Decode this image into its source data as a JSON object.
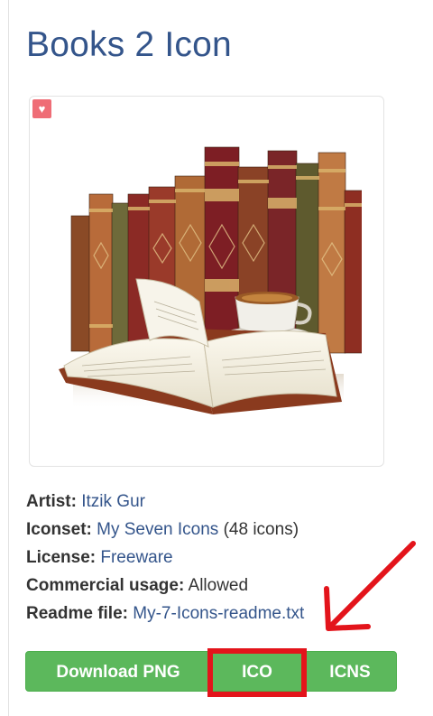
{
  "title": "Books 2 Icon",
  "favorite_icon": "heart-icon",
  "details": {
    "artist_label": "Artist:",
    "artist_value": "Itzik Gur",
    "iconset_label": "Iconset:",
    "iconset_value": "My Seven Icons",
    "iconset_count": "(48 icons)",
    "license_label": "License:",
    "license_value": "Freeware",
    "commercial_label": "Commercial usage:",
    "commercial_value": "Allowed",
    "readme_label": "Readme file:",
    "readme_value": "My-7-Icons-readme.txt"
  },
  "buttons": {
    "png": "Download PNG",
    "ico": "ICO",
    "icns": "ICNS"
  },
  "colors": {
    "title": "#34558b",
    "button_green": "#5cb85c",
    "annotation_red": "#e3141b",
    "favorite_pink": "#ef6d76"
  }
}
